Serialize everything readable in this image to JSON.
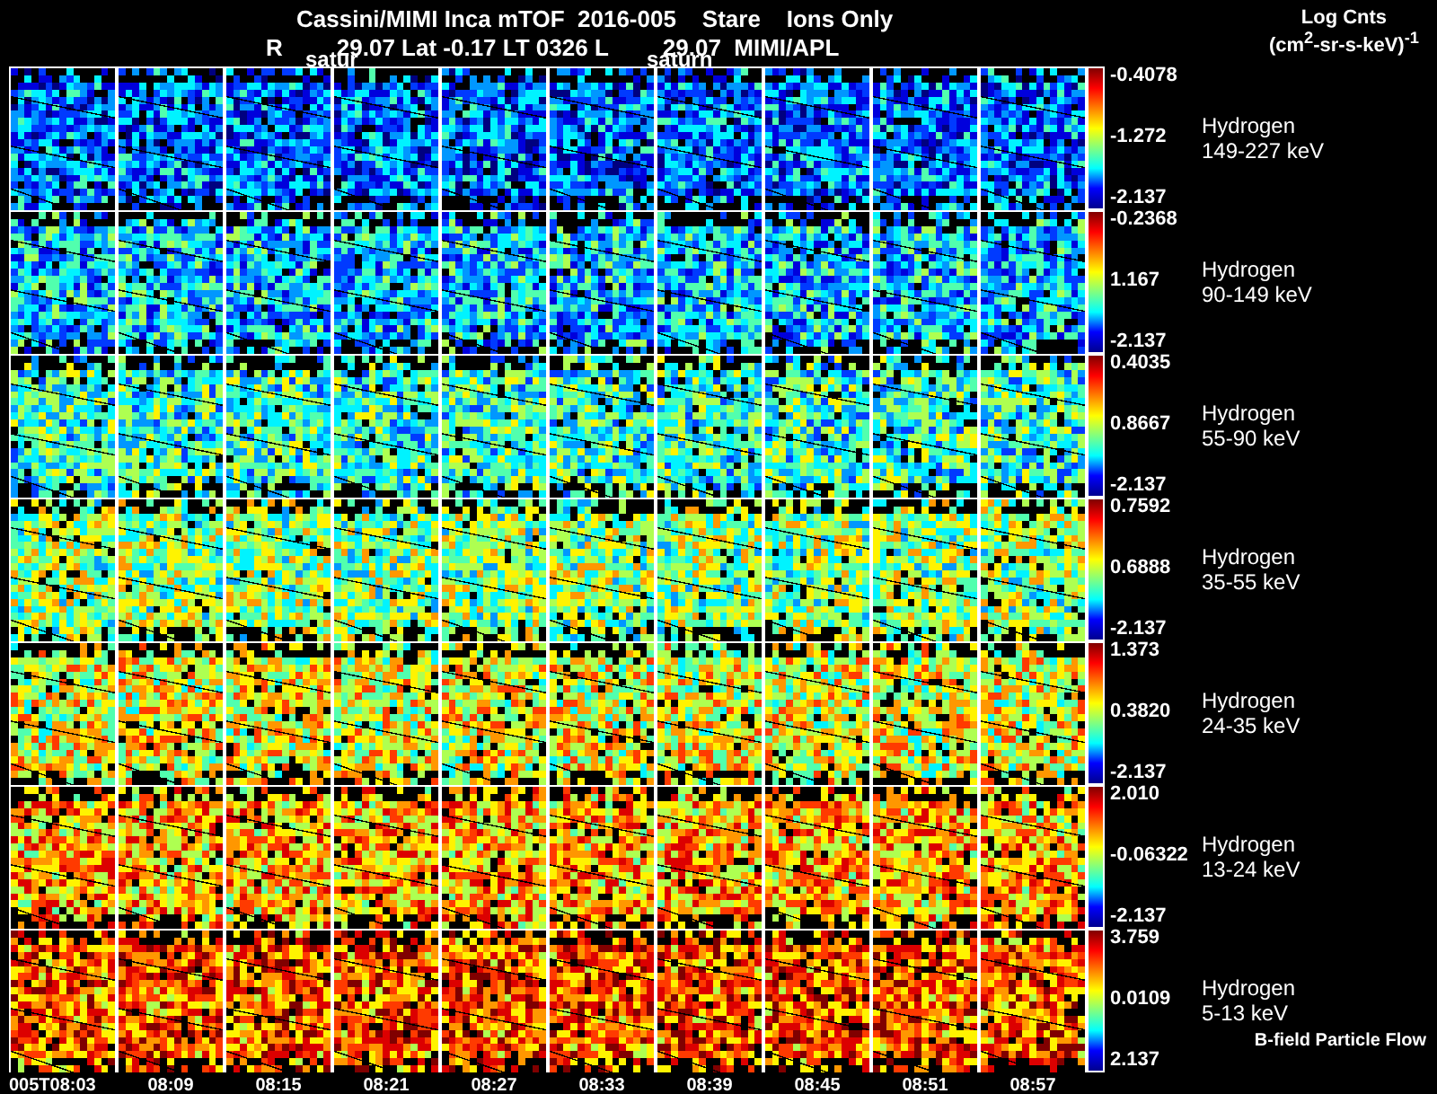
{
  "header": {
    "title": "Cassini/MIMI Inca mTOF  2016-005    Stare    Ions Only",
    "line2": [
      "R",
      "29.07 Lat -0.17 LT 0326 L",
      "29.07  MIMI/APL"
    ],
    "overlay_labels": [
      "satur",
      "saturn"
    ],
    "units_title": "Log Cnts",
    "units": "(cm$^{2}$-sr-s-keV)$^{-1}$"
  },
  "rows": [
    {
      "species": "Hydrogen",
      "energy": "149-227 keV",
      "max": "-0.4078",
      "mid": "-1.272",
      "min": "-2.137"
    },
    {
      "species": "Hydrogen",
      "energy": "90-149 keV",
      "max": "-0.2368",
      "mid": "1.167",
      "min": "-2.137"
    },
    {
      "species": "Hydrogen",
      "energy": "55-90 keV",
      "max": "0.4035",
      "mid": "0.8667",
      "min": "-2.137"
    },
    {
      "species": "Hydrogen",
      "energy": "35-55 keV",
      "max": "0.7592",
      "mid": "0.6888",
      "min": "-2.137"
    },
    {
      "species": "Hydrogen",
      "energy": "24-35 keV",
      "max": "1.373",
      "mid": "0.3820",
      "min": "-2.137"
    },
    {
      "species": "Hydrogen",
      "energy": "13-24 keV",
      "max": "2.010",
      "mid": "-0.06322",
      "min": "-2.137"
    },
    {
      "species": "Hydrogen",
      "energy": "5-13 keV",
      "max": "3.759",
      "mid": "0.0109",
      "min": "2.137"
    }
  ],
  "footnote": "B-field Particle Flow",
  "times": [
    "005T08:03",
    "08:09",
    "08:15",
    "08:21",
    "08:27",
    "08:33",
    "08:39",
    "08:45",
    "08:51",
    "08:57"
  ]
}
